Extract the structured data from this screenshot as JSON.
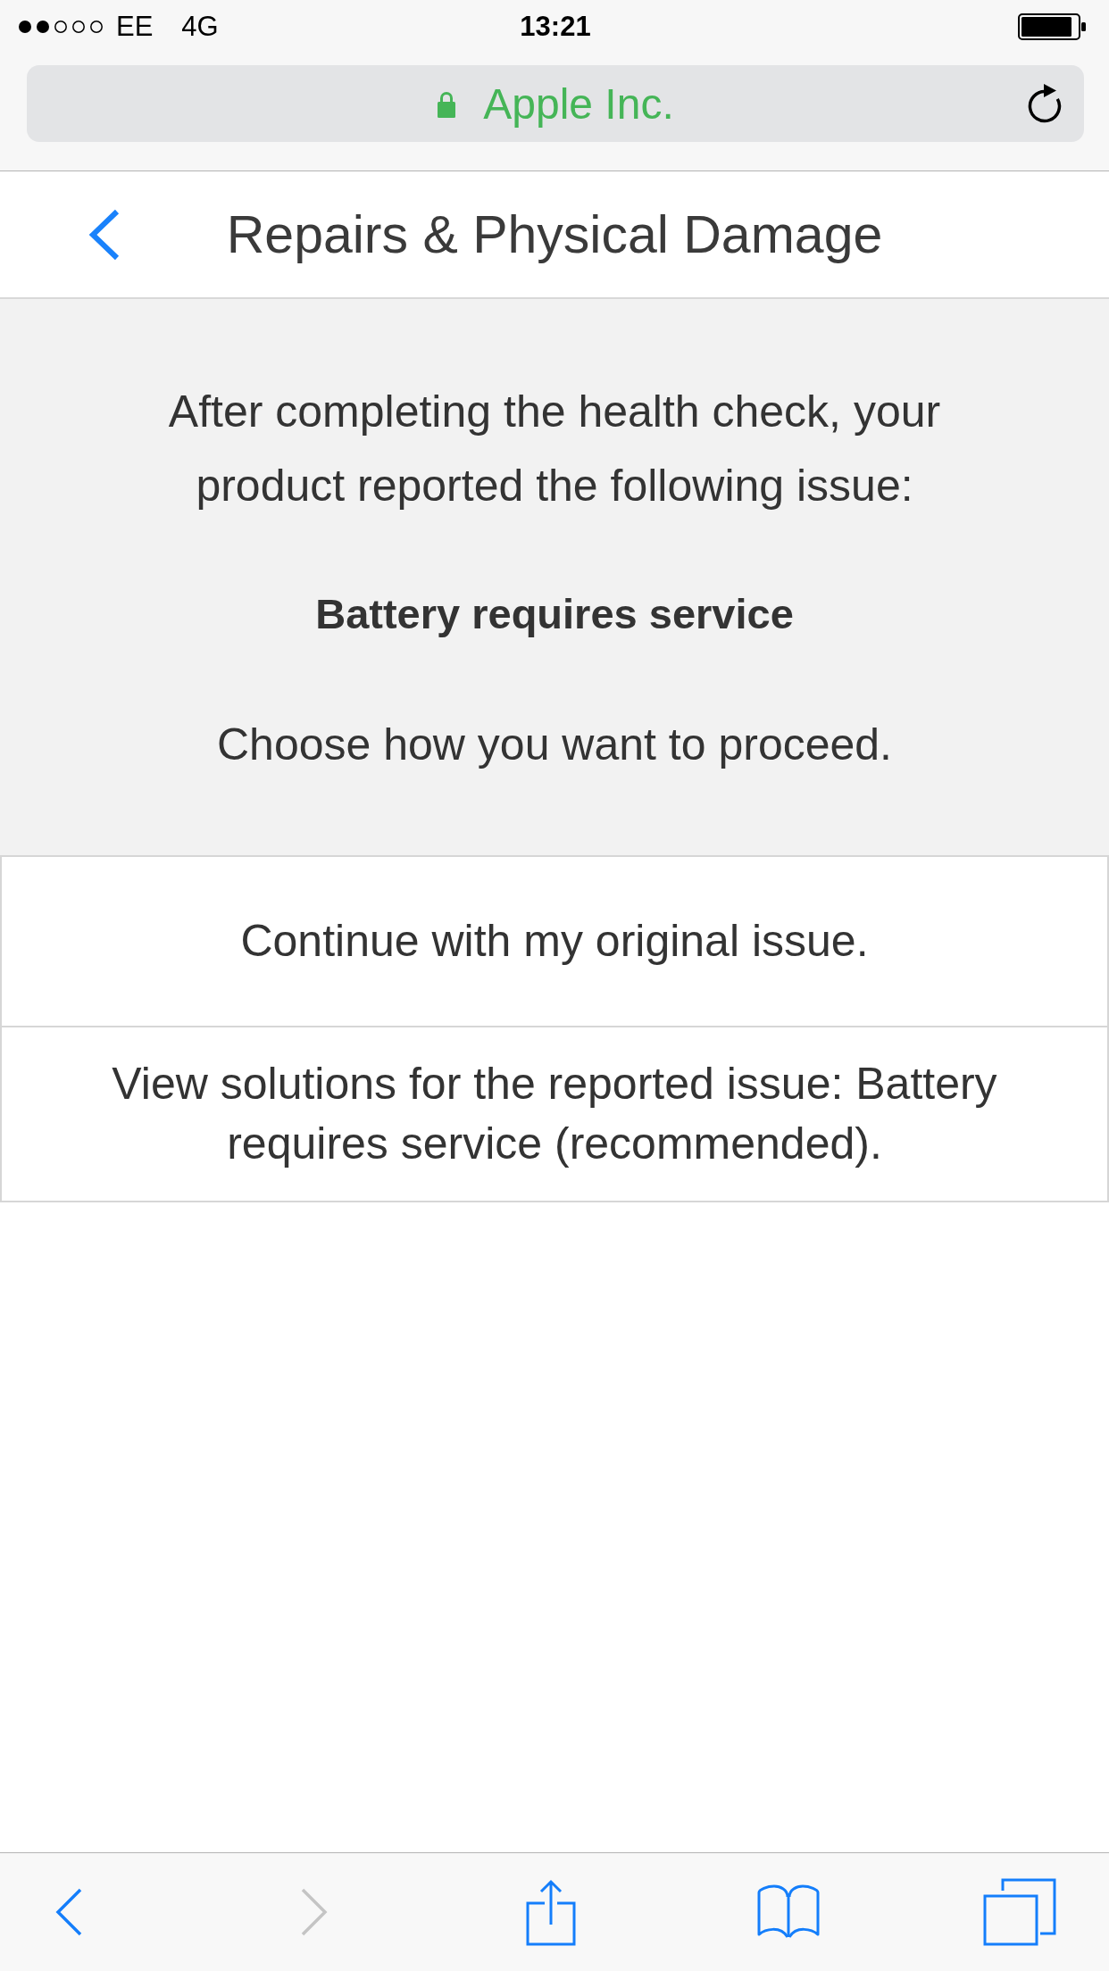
{
  "status_bar": {
    "carrier": "EE",
    "network": "4G",
    "time": "13:21"
  },
  "address_bar": {
    "secure": true,
    "site": "Apple Inc."
  },
  "header": {
    "title": "Repairs & Physical Damage"
  },
  "message": {
    "intro": "After completing the health check, your product reported the following issue:",
    "issue": "Battery requires service",
    "prompt": "Choose how you want to proceed."
  },
  "options": [
    {
      "label": "Continue with my original issue."
    },
    {
      "label": "View solutions for the reported issue: Battery requires service (recommended)."
    }
  ],
  "toolbar": [
    {
      "kind": "back",
      "disabled": false
    },
    {
      "kind": "forward",
      "disabled": true
    },
    {
      "kind": "share",
      "disabled": false
    },
    {
      "kind": "bookmarks",
      "disabled": false
    },
    {
      "kind": "tabs",
      "disabled": false
    }
  ]
}
